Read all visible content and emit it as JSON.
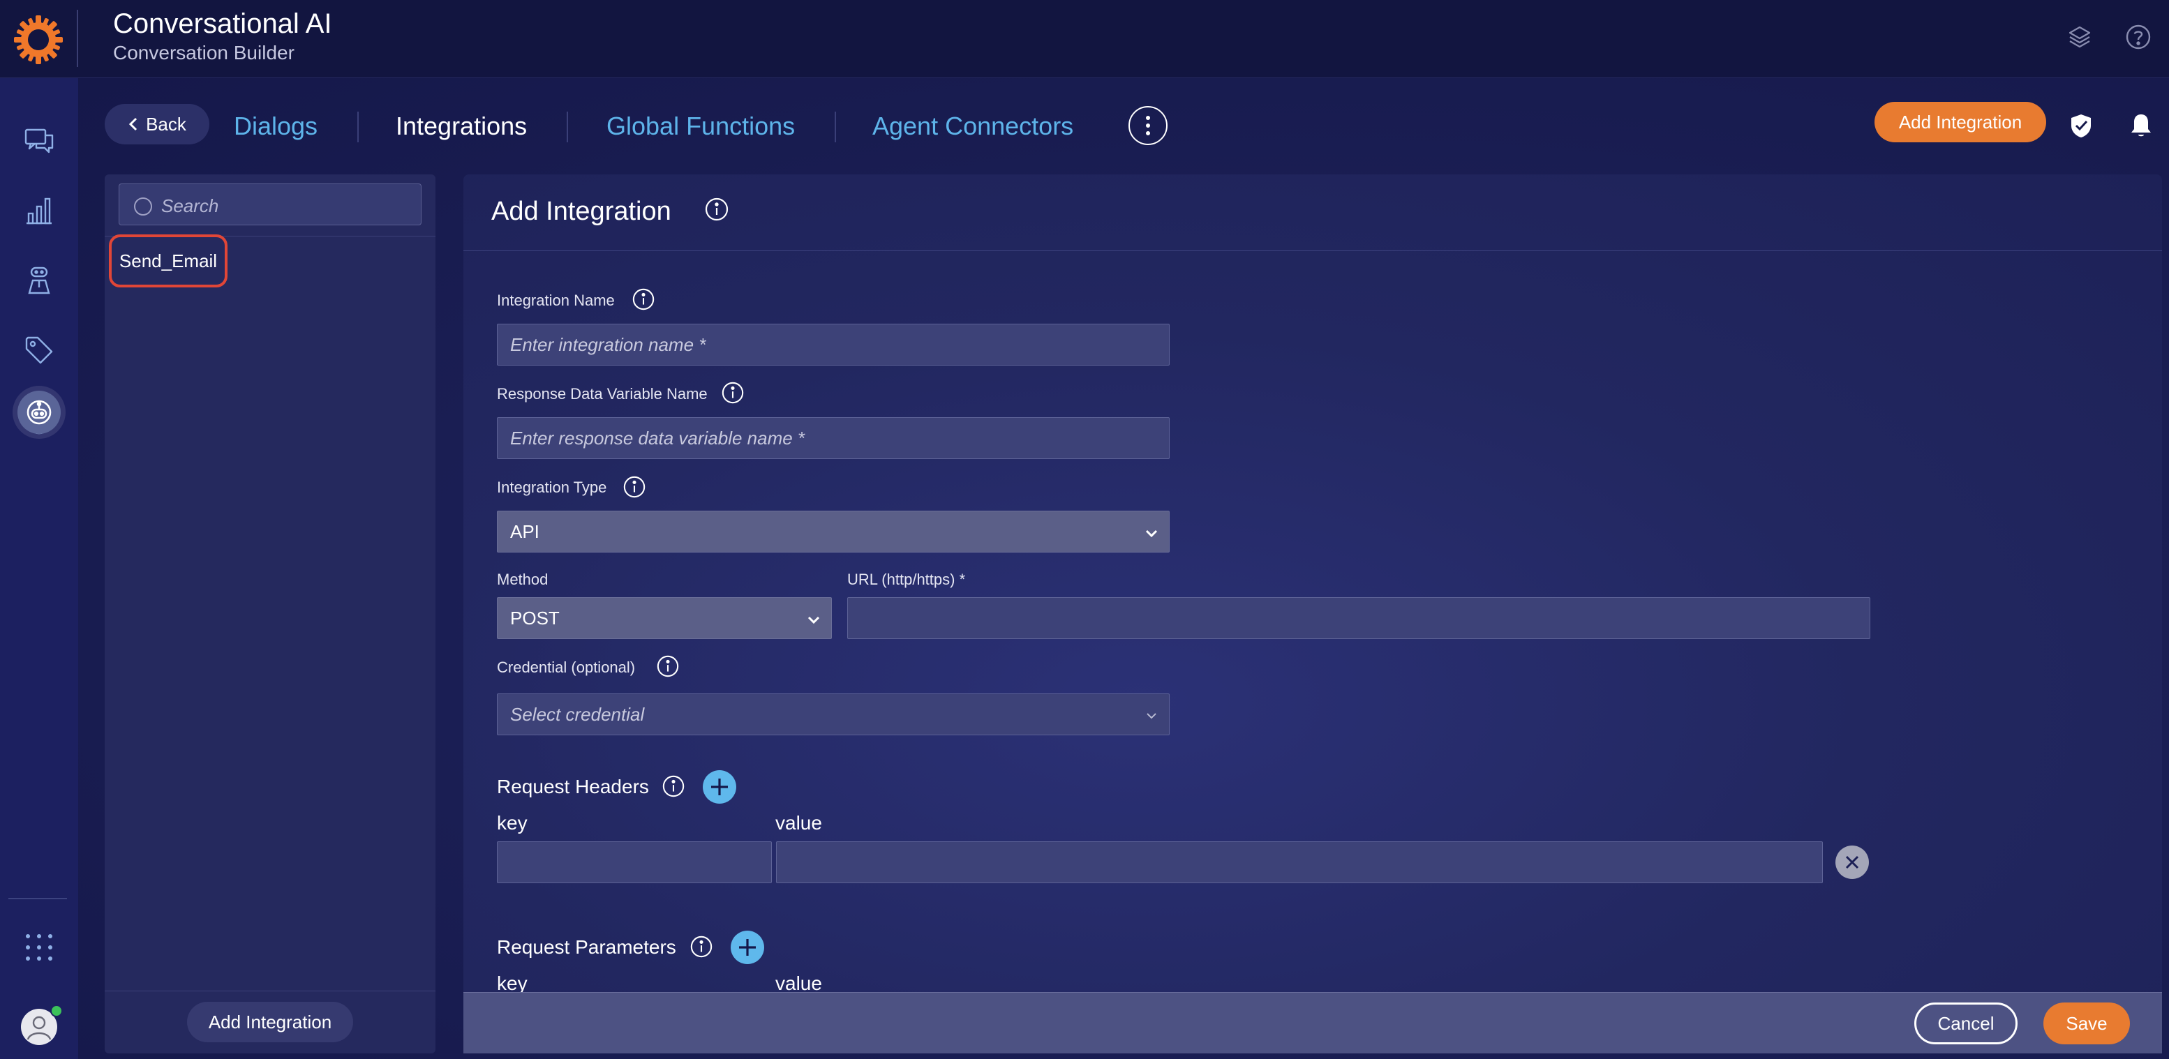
{
  "app": {
    "title": "Conversational AI",
    "subtitle": "Conversation Builder"
  },
  "colors": {
    "accent_orange": "#e87b30",
    "link_blue": "#5eb4ea",
    "highlight_red": "#e14637",
    "online_green": "#3cc25a"
  },
  "topbar_icons": [
    "layers-icon",
    "help-icon"
  ],
  "rail": {
    "icons": [
      "conversations-icon",
      "analytics-icon",
      "agent-icon",
      "tags-icon",
      "user-profile-icon",
      "bot-icon",
      "apps-grid-icon"
    ],
    "active": "bot-icon"
  },
  "nav": {
    "back_label": "Back",
    "tabs": [
      {
        "label": "Dialogs",
        "active": false
      },
      {
        "label": "Integrations",
        "active": true
      },
      {
        "label": "Global Functions",
        "active": false
      },
      {
        "label": "Agent Connectors",
        "active": false
      }
    ],
    "more_icon": "more-vertical-icon",
    "add_integration_label": "Add Integration",
    "header_icons": [
      "security-shield-icon",
      "notification-bell-icon"
    ]
  },
  "list": {
    "search_placeholder": "Search",
    "items": [
      "Send_Email"
    ],
    "add_integration_label": "Add Integration"
  },
  "form": {
    "title": "Add Integration",
    "integration_name": {
      "label": "Integration Name",
      "placeholder": "Enter integration name *",
      "value": ""
    },
    "response_variable": {
      "label": "Response Data Variable Name",
      "placeholder": "Enter response data variable name *",
      "value": ""
    },
    "integration_type": {
      "label": "Integration Type",
      "value": "API"
    },
    "method": {
      "label": "Method",
      "value": "POST"
    },
    "url": {
      "label": "URL (http/https) *",
      "value": ""
    },
    "credential": {
      "label": "Credential (optional)",
      "placeholder": "Select credential"
    },
    "request_headers": {
      "label": "Request Headers",
      "key_label": "key",
      "value_label": "value",
      "rows": [
        {
          "key": "",
          "value": ""
        }
      ]
    },
    "request_parameters": {
      "label": "Request Parameters",
      "key_label": "key",
      "value_label": "value"
    }
  },
  "footer": {
    "cancel_label": "Cancel",
    "save_label": "Save"
  }
}
